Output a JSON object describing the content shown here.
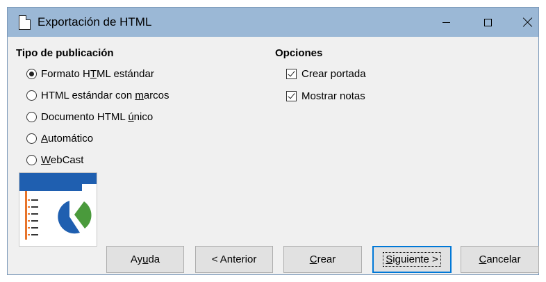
{
  "window": {
    "title": "Exportación de HTML",
    "controls": {
      "minimize": "minimize",
      "maximize": "maximize",
      "close": "close"
    }
  },
  "publication_type": {
    "heading": "Tipo de publicación",
    "selected": 0,
    "options": [
      {
        "pre": "Formato H",
        "mn": "T",
        "post": "ML estándar"
      },
      {
        "pre": "HTML estándar con ",
        "mn": "m",
        "post": "arcos"
      },
      {
        "pre": "Documento HTML ",
        "mn": "ú",
        "post": "nico"
      },
      {
        "pre": "",
        "mn": "A",
        "post": "utomático"
      },
      {
        "pre": "",
        "mn": "W",
        "post": "ebCast"
      }
    ]
  },
  "options": {
    "heading": "Opciones",
    "items": [
      {
        "label": "Crear portada",
        "checked": true
      },
      {
        "label": "Mostrar notas",
        "checked": true
      }
    ]
  },
  "buttons": {
    "help": {
      "pre": "Ay",
      "mn": "u",
      "post": "da"
    },
    "back": {
      "pre": "< Anterior",
      "mn": "",
      "post": ""
    },
    "create": {
      "pre": "",
      "mn": "C",
      "post": "rear"
    },
    "next": {
      "pre": "",
      "mn": "S",
      "post": "iguiente >"
    },
    "cancel": {
      "pre": "",
      "mn": "C",
      "post": "ancelar"
    }
  },
  "colors": {
    "titlebar": "#9bb8d6",
    "preview_blue": "#1f5fb0",
    "preview_green": "#4a9a3c",
    "preview_orange": "#e8742a",
    "focus_border": "#0078d7"
  }
}
